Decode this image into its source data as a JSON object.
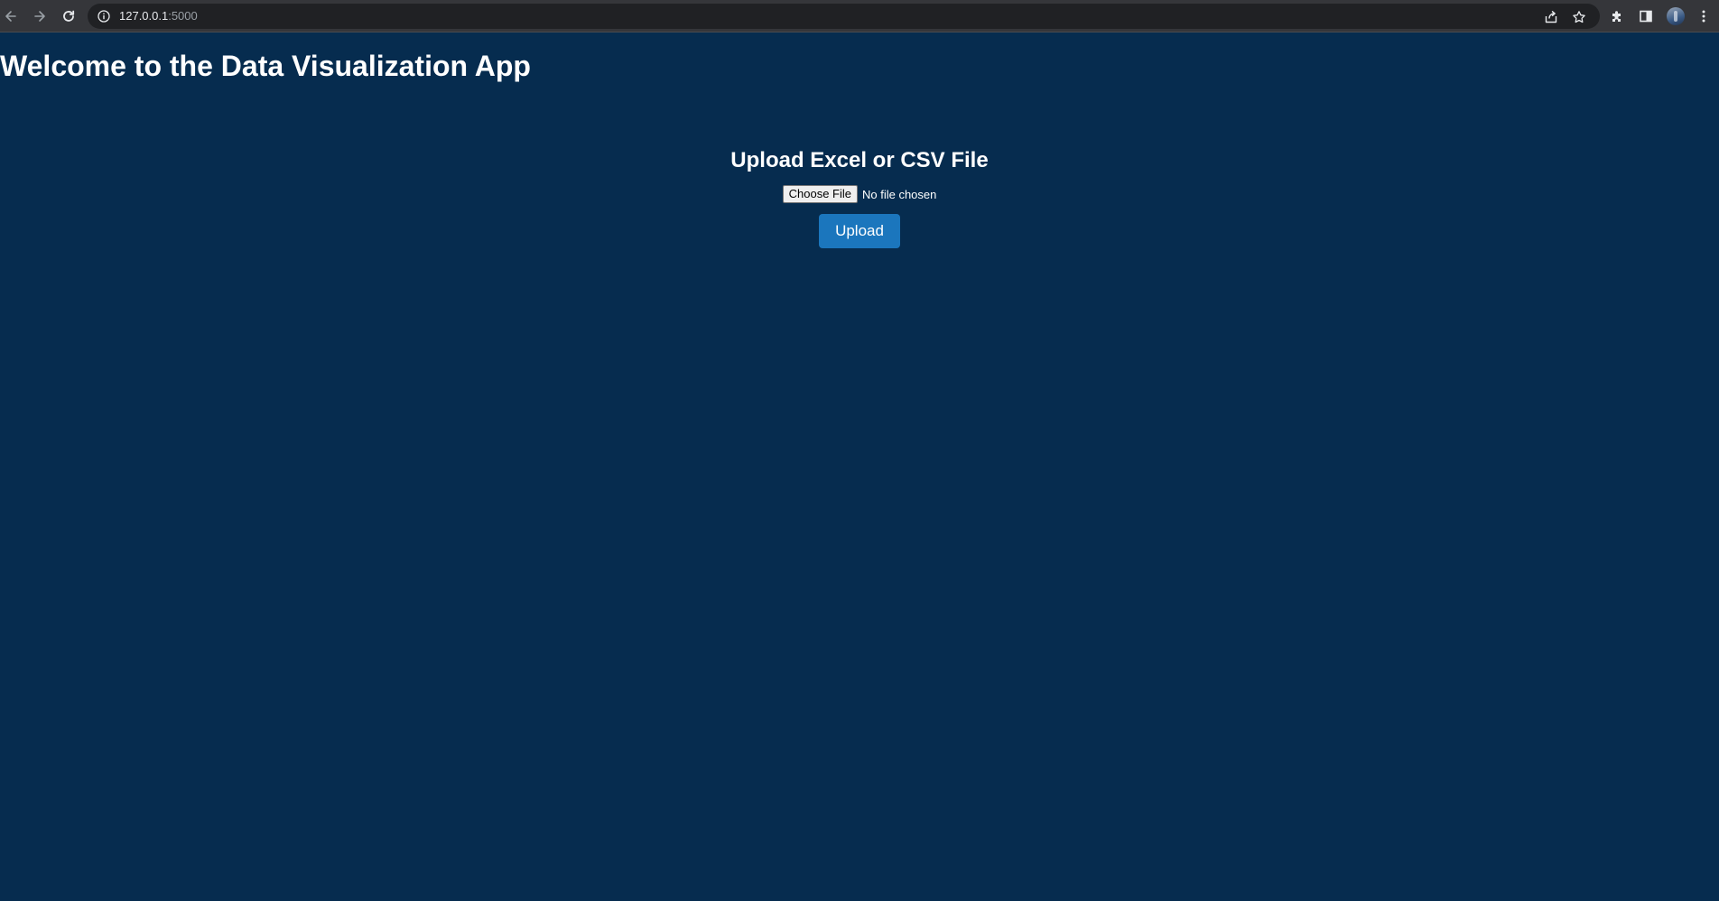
{
  "browser": {
    "url_host": "127.0.0.1",
    "url_port": ":5000",
    "icons": {
      "back": "arrow-left-icon",
      "forward": "arrow-right-icon",
      "reload": "reload-icon",
      "site_info": "info-icon",
      "share": "share-icon",
      "bookmark": "star-icon",
      "extensions": "puzzle-icon",
      "side_panel": "side-panel-icon",
      "profile": "avatar",
      "menu": "kebab-menu-icon"
    }
  },
  "page": {
    "title": "Welcome to the Data Visualization App",
    "background_color": "#062c4f"
  },
  "upload": {
    "heading": "Upload Excel or CSV File",
    "choose_file_label": "Choose File",
    "file_status": "No file chosen",
    "submit_label": "Upload",
    "submit_color": "#1b76bd"
  }
}
